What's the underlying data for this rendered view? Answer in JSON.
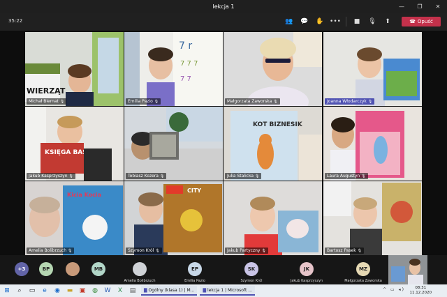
{
  "window": {
    "title": "lekcja 1"
  },
  "toolbar": {
    "timer": "35:22",
    "leave_label": "Opuść"
  },
  "participants": [
    {
      "name": "Michał Biernat"
    },
    {
      "name": "Emilia Pazio"
    },
    {
      "name": "Małgorzata Zaworska"
    },
    {
      "name": "Joanna Włodarczyk"
    },
    {
      "name": "Jakub Kasprzyszyn"
    },
    {
      "name": "Tobiasz Kozera"
    },
    {
      "name": "Julia Stalicka"
    },
    {
      "name": "Laura Augustyn"
    },
    {
      "name": "Amelia Bolibrzuch"
    },
    {
      "name": "Szymon Król"
    },
    {
      "name": "Jakub Partyczny"
    },
    {
      "name": "Bartosz Pasek"
    }
  ],
  "books": {
    "zwierzat": "WIERZĄT",
    "ksiega": "KSIĘGA BAŚNI",
    "kot": "KOT BIZNESIK",
    "kicia": "Kicia Kocia",
    "city": "CITY"
  },
  "overflow": {
    "more_count": "+3",
    "bubbles": [
      {
        "initials": "BP",
        "color": "#b5d6b2"
      },
      {
        "initials": "MB",
        "color": "#b2d6c8"
      }
    ],
    "people": [
      {
        "name": "Amelia Bolibrzuch",
        "initials": "",
        "color": "#cfd2d6"
      },
      {
        "name": "Emilia Pazio",
        "initials": "EP",
        "color": "#c8d8e8"
      },
      {
        "name": "Szymon Król",
        "initials": "SK",
        "color": "#c9c4e6"
      },
      {
        "name": "Jakub Kasprzyszyn",
        "initials": "JK",
        "color": "#e6c4c9"
      },
      {
        "name": "Małgorzata Zaworska",
        "initials": "MZ",
        "color": "#e6d9b4"
      }
    ]
  },
  "taskbar": {
    "app1": "Ogólny (klasa 1) | M...",
    "app2": "lekcja 1 | Microsoft ...",
    "time": "08:31",
    "date": "11.12.2020"
  }
}
